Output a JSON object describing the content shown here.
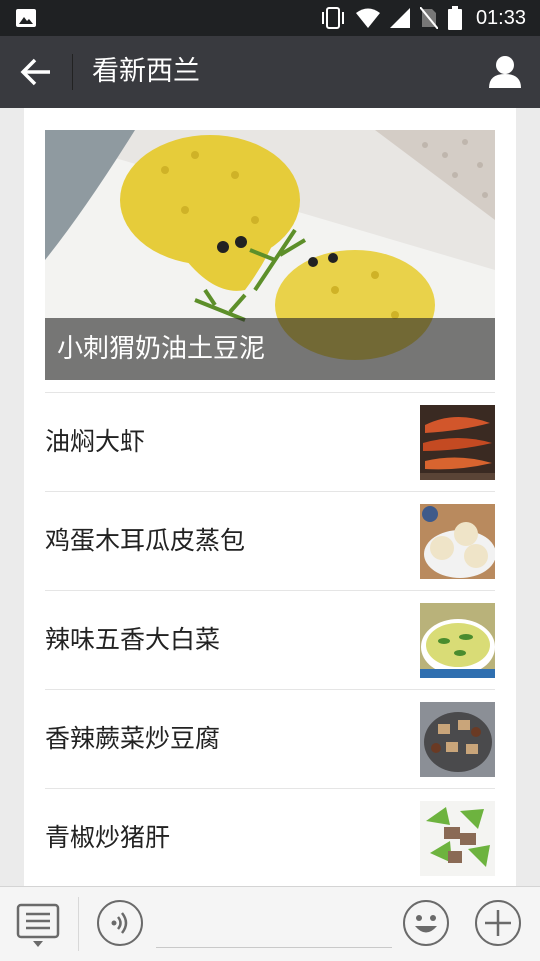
{
  "status_bar": {
    "time": "01:33",
    "icons": [
      "gallery-icon",
      "vibrate-icon",
      "wifi-icon",
      "signal-icon",
      "no-sim-icon",
      "battery-icon"
    ]
  },
  "navbar": {
    "title": "看新西兰",
    "back_icon": "arrow-left-icon",
    "profile_icon": "person-icon"
  },
  "hero": {
    "caption": "小刺猬奶油土豆泥"
  },
  "articles": [
    {
      "title": "油焖大虾",
      "thumb": "shrimp-dish"
    },
    {
      "title": "鸡蛋木耳瓜皮蒸包",
      "thumb": "steamed-buns"
    },
    {
      "title": "辣味五香大白菜",
      "thumb": "cabbage-dish"
    },
    {
      "title": "香辣蕨菜炒豆腐",
      "thumb": "tofu-fern-dish"
    },
    {
      "title": "青椒炒猪肝",
      "thumb": "pepper-liver-dish"
    }
  ],
  "bottom_bar": {
    "icons": [
      "menu-icon",
      "voice-icon",
      "emoji-icon",
      "plus-icon"
    ],
    "input_value": ""
  },
  "colors": {
    "navbar": "#393a3f",
    "status_bar": "#1f2123",
    "background": "#ebebeb"
  }
}
